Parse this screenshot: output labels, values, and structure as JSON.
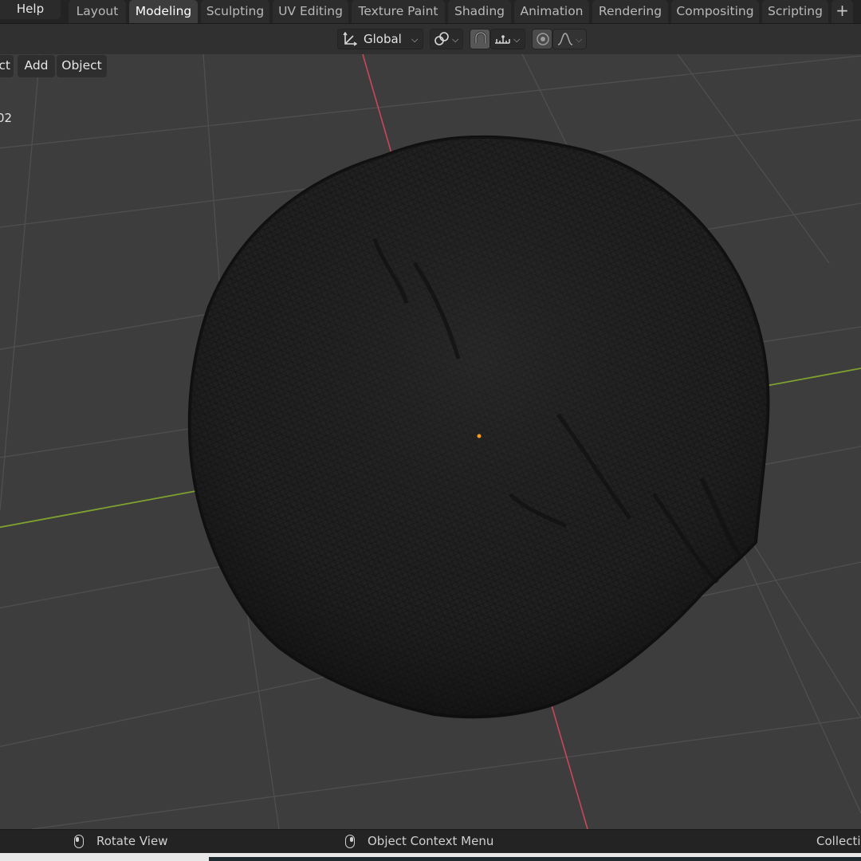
{
  "menu": {
    "help": "Help"
  },
  "workspace_tabs": [
    {
      "label": "Layout",
      "active": false
    },
    {
      "label": "Modeling",
      "active": true
    },
    {
      "label": "Sculpting",
      "active": false
    },
    {
      "label": "UV Editing",
      "active": false
    },
    {
      "label": "Texture Paint",
      "active": false
    },
    {
      "label": "Shading",
      "active": false
    },
    {
      "label": "Animation",
      "active": false
    },
    {
      "label": "Rendering",
      "active": false
    },
    {
      "label": "Compositing",
      "active": false
    },
    {
      "label": "Scripting",
      "active": false
    }
  ],
  "add_tab_label": "+",
  "header": {
    "transform_orientation": "Global",
    "transform_icon": "axes-icon",
    "pivot_icon": "link-icon",
    "snap_icon": "magnet-icon",
    "snap_target_icon": "snap-increment-icon",
    "proportional_icon": "proportional-edit-icon",
    "falloff_icon": "falloff-curve-icon"
  },
  "viewport_menu": {
    "select_partial": "ct",
    "add": "Add",
    "object": "Object"
  },
  "object_info_partial": "02",
  "viewport": {
    "background": "#3d3d3d",
    "grid_color": "#545454",
    "x_axis_color": "#c9475b",
    "y_axis_color": "#7fa12f",
    "mesh_color": "#1b1b1b",
    "origin_color": "#ff9a1f"
  },
  "statusbar": {
    "rotate_view": "Rotate View",
    "context_menu": "Object Context Menu",
    "collection_partial": "Collectio",
    "left_mouse_icon": "mouse-left-icon",
    "right_mouse_icon": "mouse-right-icon"
  }
}
